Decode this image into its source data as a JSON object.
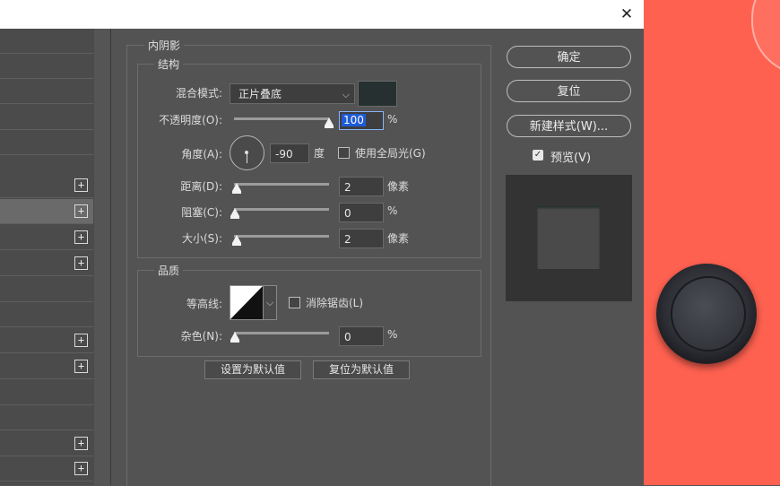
{
  "dialog": {
    "close_glyph": "✕"
  },
  "section_title": "内阴影",
  "structure": {
    "title": "结构",
    "blend_mode": {
      "label": "混合模式:",
      "value": "正片叠底",
      "color": "#263031"
    },
    "opacity": {
      "label": "不透明度(O):",
      "value": "100",
      "unit": "%",
      "slider_fraction": 1.0
    },
    "angle": {
      "label": "角度(A):",
      "value": "-90",
      "unit": "度",
      "global_light_label": "使用全局光(G)",
      "global_light_checked": false
    },
    "distance": {
      "label": "距离(D):",
      "value": "2",
      "unit": "像素",
      "slider_fraction": 0.02
    },
    "choke": {
      "label": "阻塞(C):",
      "value": "0",
      "unit": "%",
      "slider_fraction": 0.0
    },
    "size": {
      "label": "大小(S):",
      "value": "2",
      "unit": "像素",
      "slider_fraction": 0.02
    }
  },
  "quality": {
    "title": "品质",
    "contour": {
      "label": "等高线:",
      "anti_alias_label": "消除锯齿(L)",
      "anti_alias_checked": false
    },
    "noise": {
      "label": "杂色(N):",
      "value": "0",
      "unit": "%",
      "slider_fraction": 0.0
    }
  },
  "buttons": {
    "make_default": "设置为默认值",
    "reset_default": "复位为默认值",
    "ok": "确定",
    "reset": "复位",
    "new_style": "新建样式(W)...",
    "preview_label": "预览(V)",
    "preview_checked": true
  },
  "left_list": {
    "plus_glyph": "+"
  },
  "colors": {
    "accent_orange": "#fe6150",
    "selection_blue": "#1e5bd6"
  }
}
